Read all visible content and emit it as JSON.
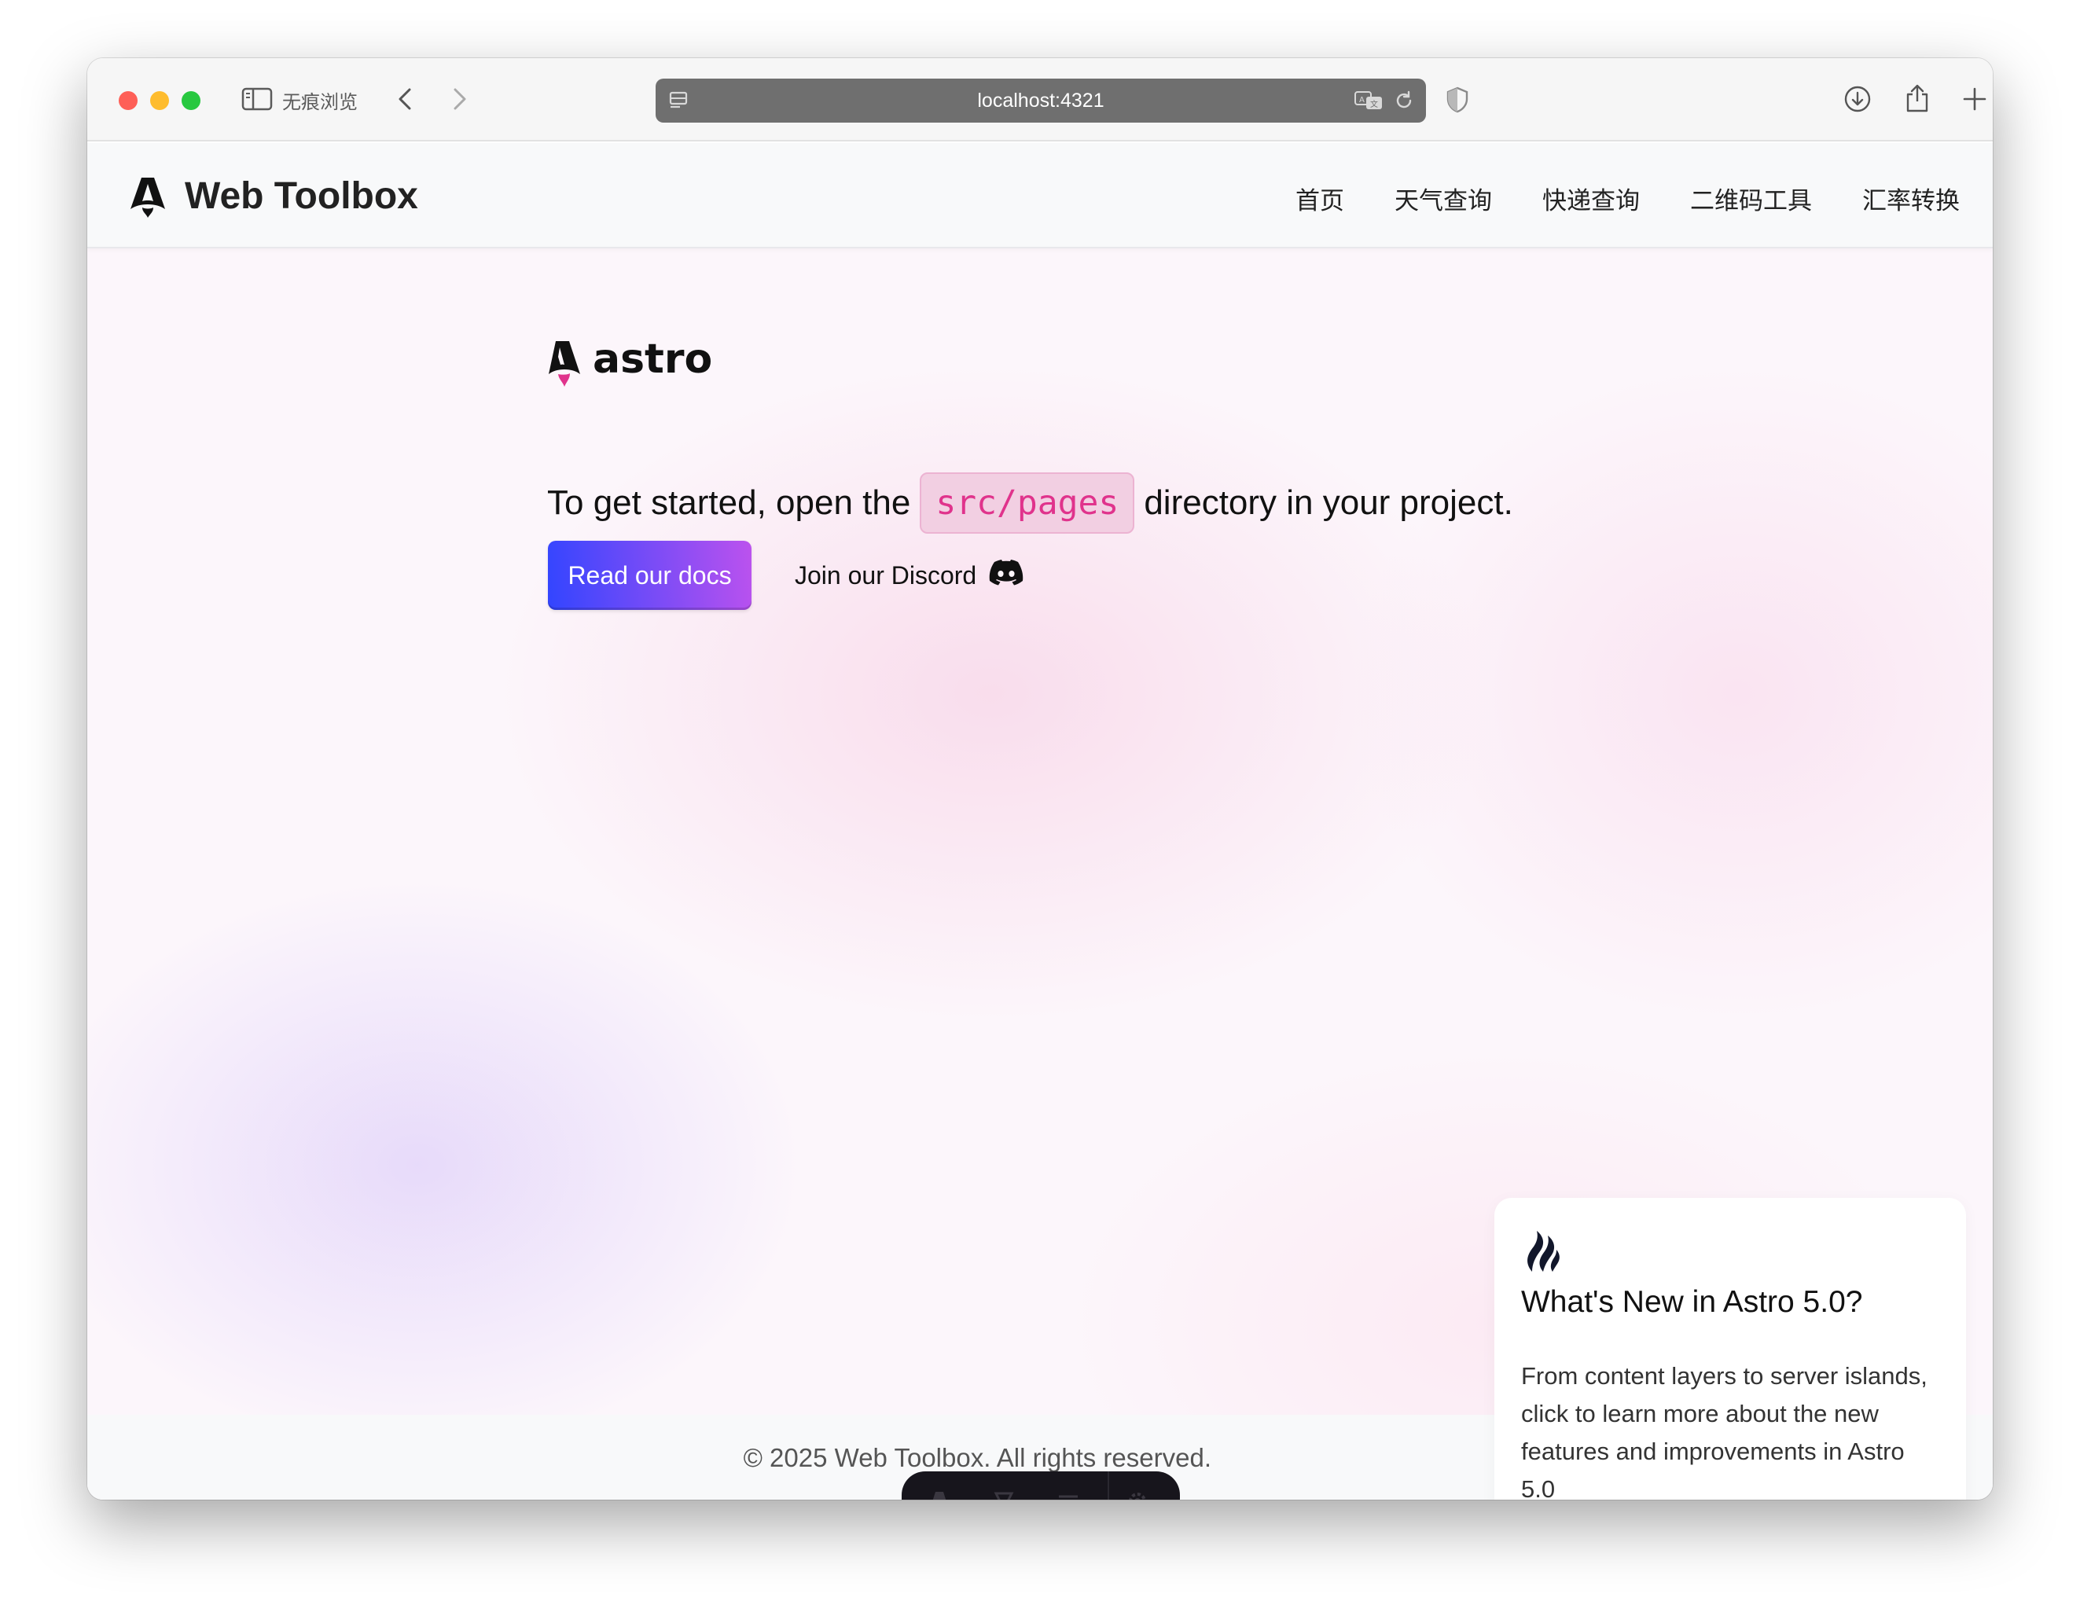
{
  "browser": {
    "private_label": "无痕浏览",
    "url": "localhost:4321",
    "colors": {
      "close": "#fe5f57",
      "minimize": "#febc2e",
      "maximize": "#28c840"
    }
  },
  "header": {
    "brand": "Web Toolbox",
    "nav": [
      "首页",
      "天气查询",
      "快递查询",
      "二维码工具",
      "汇率转换"
    ]
  },
  "hero": {
    "logo_text": "astro",
    "intro_before": "To get started, open the",
    "code": "src/pages",
    "intro_after": "directory in your project.",
    "docs_button": "Read our docs",
    "discord_link": "Join our Discord"
  },
  "news_card": {
    "title": "What's New in Astro 5.0?",
    "body": "From content layers to server islands, click to learn more about the new features and improvements in Astro 5.0"
  },
  "footer": {
    "text": "© 2025 Web Toolbox. All rights reserved."
  },
  "colors": {
    "accent_start": "#3245ff",
    "accent_end": "#bc52ee",
    "code_text": "#e0338c"
  }
}
